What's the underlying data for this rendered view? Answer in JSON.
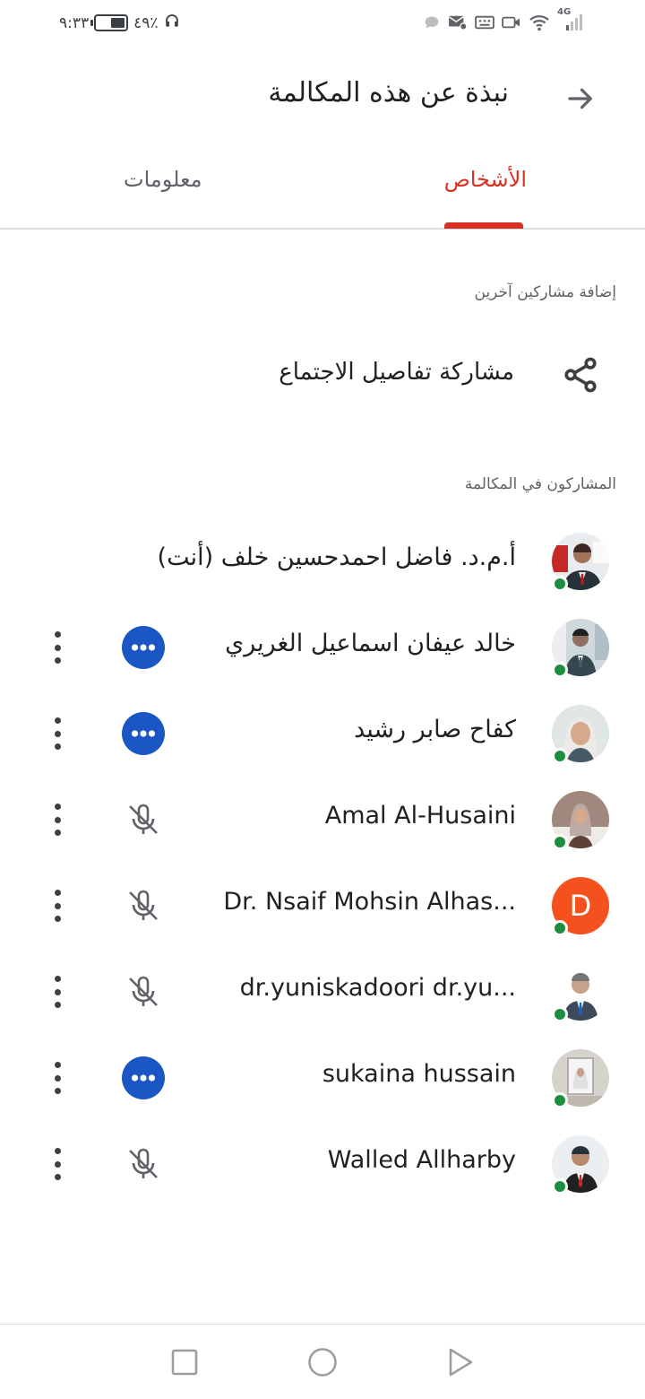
{
  "status_bar": {
    "time": "٩:٣٣",
    "battery": "٤٩٪",
    "battery_level": 0.49,
    "network": "4G"
  },
  "header": {
    "title": "نبذة عن هذه المكالمة",
    "back_icon": "arrow-forward-icon"
  },
  "tabs": [
    {
      "label": "الأشخاص",
      "active": true
    },
    {
      "label": "معلومات",
      "active": false
    }
  ],
  "colors": {
    "accent": "#d93025",
    "online": "#1e8e3e",
    "chip": "#1a56c4",
    "letter_avatar": "#f4511e"
  },
  "add_section": {
    "label": "إضافة مشاركين آخرين",
    "share_label": "مشاركة تفاصيل الاجتماع",
    "share_icon": "share-icon"
  },
  "participants_section": {
    "label": "المشاركون في المكالمة",
    "items": [
      {
        "name": "أ.م.د. فاضل احمدحسين خلف (أنت)",
        "status": "none",
        "avatar": "photo"
      },
      {
        "name": "خالد عيفان اسماعيل الغريري",
        "status": "more-chip",
        "avatar": "photo"
      },
      {
        "name": "كفاح صابر رشيد",
        "status": "more-chip",
        "avatar": "photo"
      },
      {
        "name": "Amal Al-Husaini",
        "status": "mic-off",
        "avatar": "photo"
      },
      {
        "name": "Dr. Nsaif Mohsin Alhas...",
        "status": "mic-off",
        "avatar": "letter",
        "initial": "D"
      },
      {
        "name": "dr.yuniskadoori dr.yu...",
        "status": "mic-off",
        "avatar": "photo"
      },
      {
        "name": "sukaina hussain",
        "status": "more-chip",
        "avatar": "photo"
      },
      {
        "name": "Walled Allharby",
        "status": "mic-off",
        "avatar": "photo"
      }
    ]
  },
  "nav_bar": {
    "buttons": [
      "recents-square-icon",
      "home-circle-icon",
      "back-triangle-icon"
    ]
  }
}
